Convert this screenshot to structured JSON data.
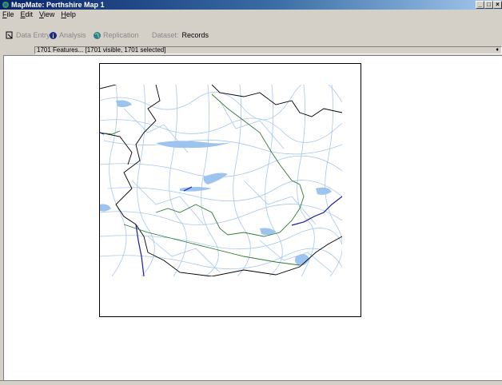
{
  "window": {
    "title": "MapMate: Perthshire Map 1"
  },
  "menu": [
    {
      "key": "F",
      "rest": "ile"
    },
    {
      "key": "E",
      "rest": "dit"
    },
    {
      "key": "V",
      "rest": "iew"
    },
    {
      "key": "H",
      "rest": "elp"
    }
  ],
  "toolbar": {
    "data_entry": "Data Entry",
    "analysis": "Analysis",
    "replication": "Replication",
    "dataset_label": "Dataset:",
    "dataset_value": "Records"
  },
  "featurebar": {
    "text": "1701 Features... [1701 visible, 1701 selected]"
  },
  "colors": {
    "river": "#a6c8ec",
    "loch": "#9cc4ee",
    "boundary": "#000000",
    "road_green": "#2e7d32",
    "major_river": "#1a1aa8",
    "title_gradient_start": "#0a246a"
  }
}
